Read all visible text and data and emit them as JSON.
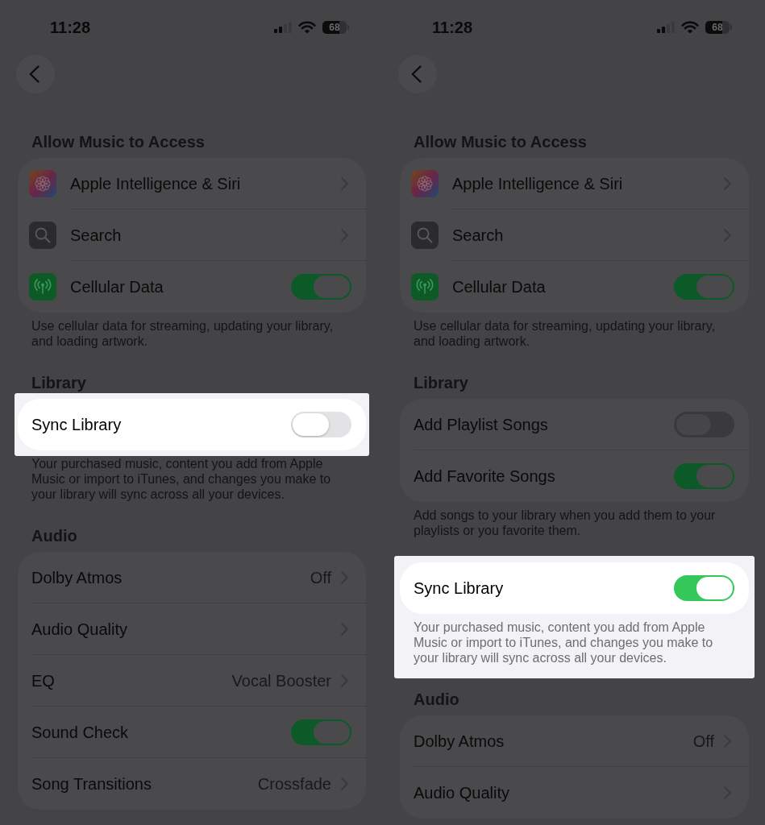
{
  "panels": [
    {
      "status_bar": {
        "time": "11:28",
        "battery": "68"
      },
      "sections": [
        {
          "kind": "app_access",
          "header": "Allow Music to Access",
          "card_highlighted": false,
          "footer_highlighted": false,
          "rows": [
            {
              "kind": "link",
              "label": "Apple Intelligence & Siri"
            },
            {
              "kind": "link",
              "label": "Search"
            },
            {
              "kind": "toggle",
              "label": "Cellular Data",
              "on": true
            }
          ],
          "footer": "Use cellular data for streaming, updating your library, and loading artwork."
        },
        {
          "kind": "plain",
          "header": "Library",
          "card_highlighted": true,
          "footer_highlighted": false,
          "rows": [
            {
              "kind": "toggle",
              "label": "Sync Library",
              "on": false
            }
          ],
          "footer": "Your purchased music, content you add from Apple Music or import to iTunes, and changes you make to your library will sync across all your devices."
        },
        {
          "kind": "plain",
          "header": "Audio",
          "card_highlighted": false,
          "rows": [
            {
              "kind": "link",
              "label": "Dolby Atmos",
              "value": "Off"
            },
            {
              "kind": "link",
              "label": "Audio Quality"
            },
            {
              "kind": "link",
              "label": "EQ",
              "value": "Vocal Booster"
            },
            {
              "kind": "toggle",
              "label": "Sound Check",
              "on": true
            },
            {
              "kind": "link",
              "label": "Song Transitions",
              "value": "Crossfade"
            }
          ]
        }
      ]
    },
    {
      "status_bar": {
        "time": "11:28",
        "battery": "68"
      },
      "sections": [
        {
          "kind": "app_access",
          "header": "Allow Music to Access",
          "card_highlighted": false,
          "footer_highlighted": false,
          "rows": [
            {
              "kind": "link",
              "label": "Apple Intelligence & Siri"
            },
            {
              "kind": "link",
              "label": "Search"
            },
            {
              "kind": "toggle",
              "label": "Cellular Data",
              "on": true
            }
          ],
          "footer": "Use cellular data for streaming, updating your library, and loading artwork."
        },
        {
          "kind": "plain",
          "header": "Library",
          "card_highlighted": false,
          "footer_highlighted": false,
          "rows": [
            {
              "kind": "toggle",
              "label": "Add Playlist Songs",
              "on": false
            },
            {
              "kind": "toggle",
              "label": "Add Favorite Songs",
              "on": true
            }
          ],
          "footer": "Add songs to your library when you add them to your playlists or you favorite them."
        },
        {
          "kind": "plain",
          "card_highlighted": true,
          "footer_highlighted": true,
          "rows": [
            {
              "kind": "toggle",
              "label": "Sync Library",
              "on": true
            }
          ],
          "footer": "Your purchased music, content you add from Apple Music or import to iTunes, and changes you make to your library will sync across all your devices."
        },
        {
          "kind": "plain",
          "header": "Audio",
          "card_highlighted": false,
          "rows": [
            {
              "kind": "link",
              "label": "Dolby Atmos",
              "value": "Off"
            },
            {
              "kind": "link",
              "label": "Audio Quality"
            }
          ]
        }
      ]
    }
  ]
}
